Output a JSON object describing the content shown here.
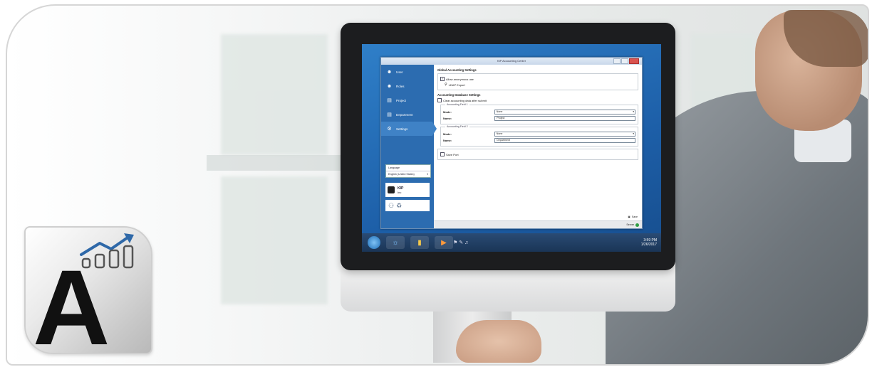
{
  "app": {
    "title": "KIP Accounting Center",
    "sidebar": {
      "items": [
        {
          "label": "User",
          "icon": "user-icon"
        },
        {
          "label": "Roles",
          "icon": "roles-icon"
        },
        {
          "label": "Project",
          "icon": "project-icon"
        },
        {
          "label": "Department",
          "icon": "department-icon"
        },
        {
          "label": "Settings",
          "icon": "gear-icon",
          "active": true
        }
      ],
      "language_label": "Language",
      "language_value": "English (United States)",
      "kip_title": "KIP",
      "kip_subtitle": "Inc"
    },
    "global": {
      "title": "Global Accounting Settings",
      "allow_anonymous": "Allow anonymous use",
      "ldap_export": "LDAP Export"
    },
    "database": {
      "title": "Accounting Database Settings",
      "clear_data": "Clear accounting data after submit"
    },
    "field1": {
      "legend": "Accounting Field 1",
      "mode_label": "Mode:",
      "mode_value": "None",
      "name_label": "Name:",
      "name_value": "Project"
    },
    "field2": {
      "legend": "Accounting Field 2",
      "mode_label": "Mode:",
      "mode_value": "None",
      "name_label": "Name:",
      "name_value": "Department"
    },
    "save_port": "Save Port",
    "save_label": "Save",
    "server_label": "Server"
  },
  "taskbar": {
    "time": "3:59 PM",
    "date": "1/26/2017"
  },
  "logo": {
    "letter": "A"
  },
  "colors": {
    "sidebar": "#2c6cb0",
    "accent": "#2a6fb8",
    "server_ok": "#2e9e44"
  }
}
